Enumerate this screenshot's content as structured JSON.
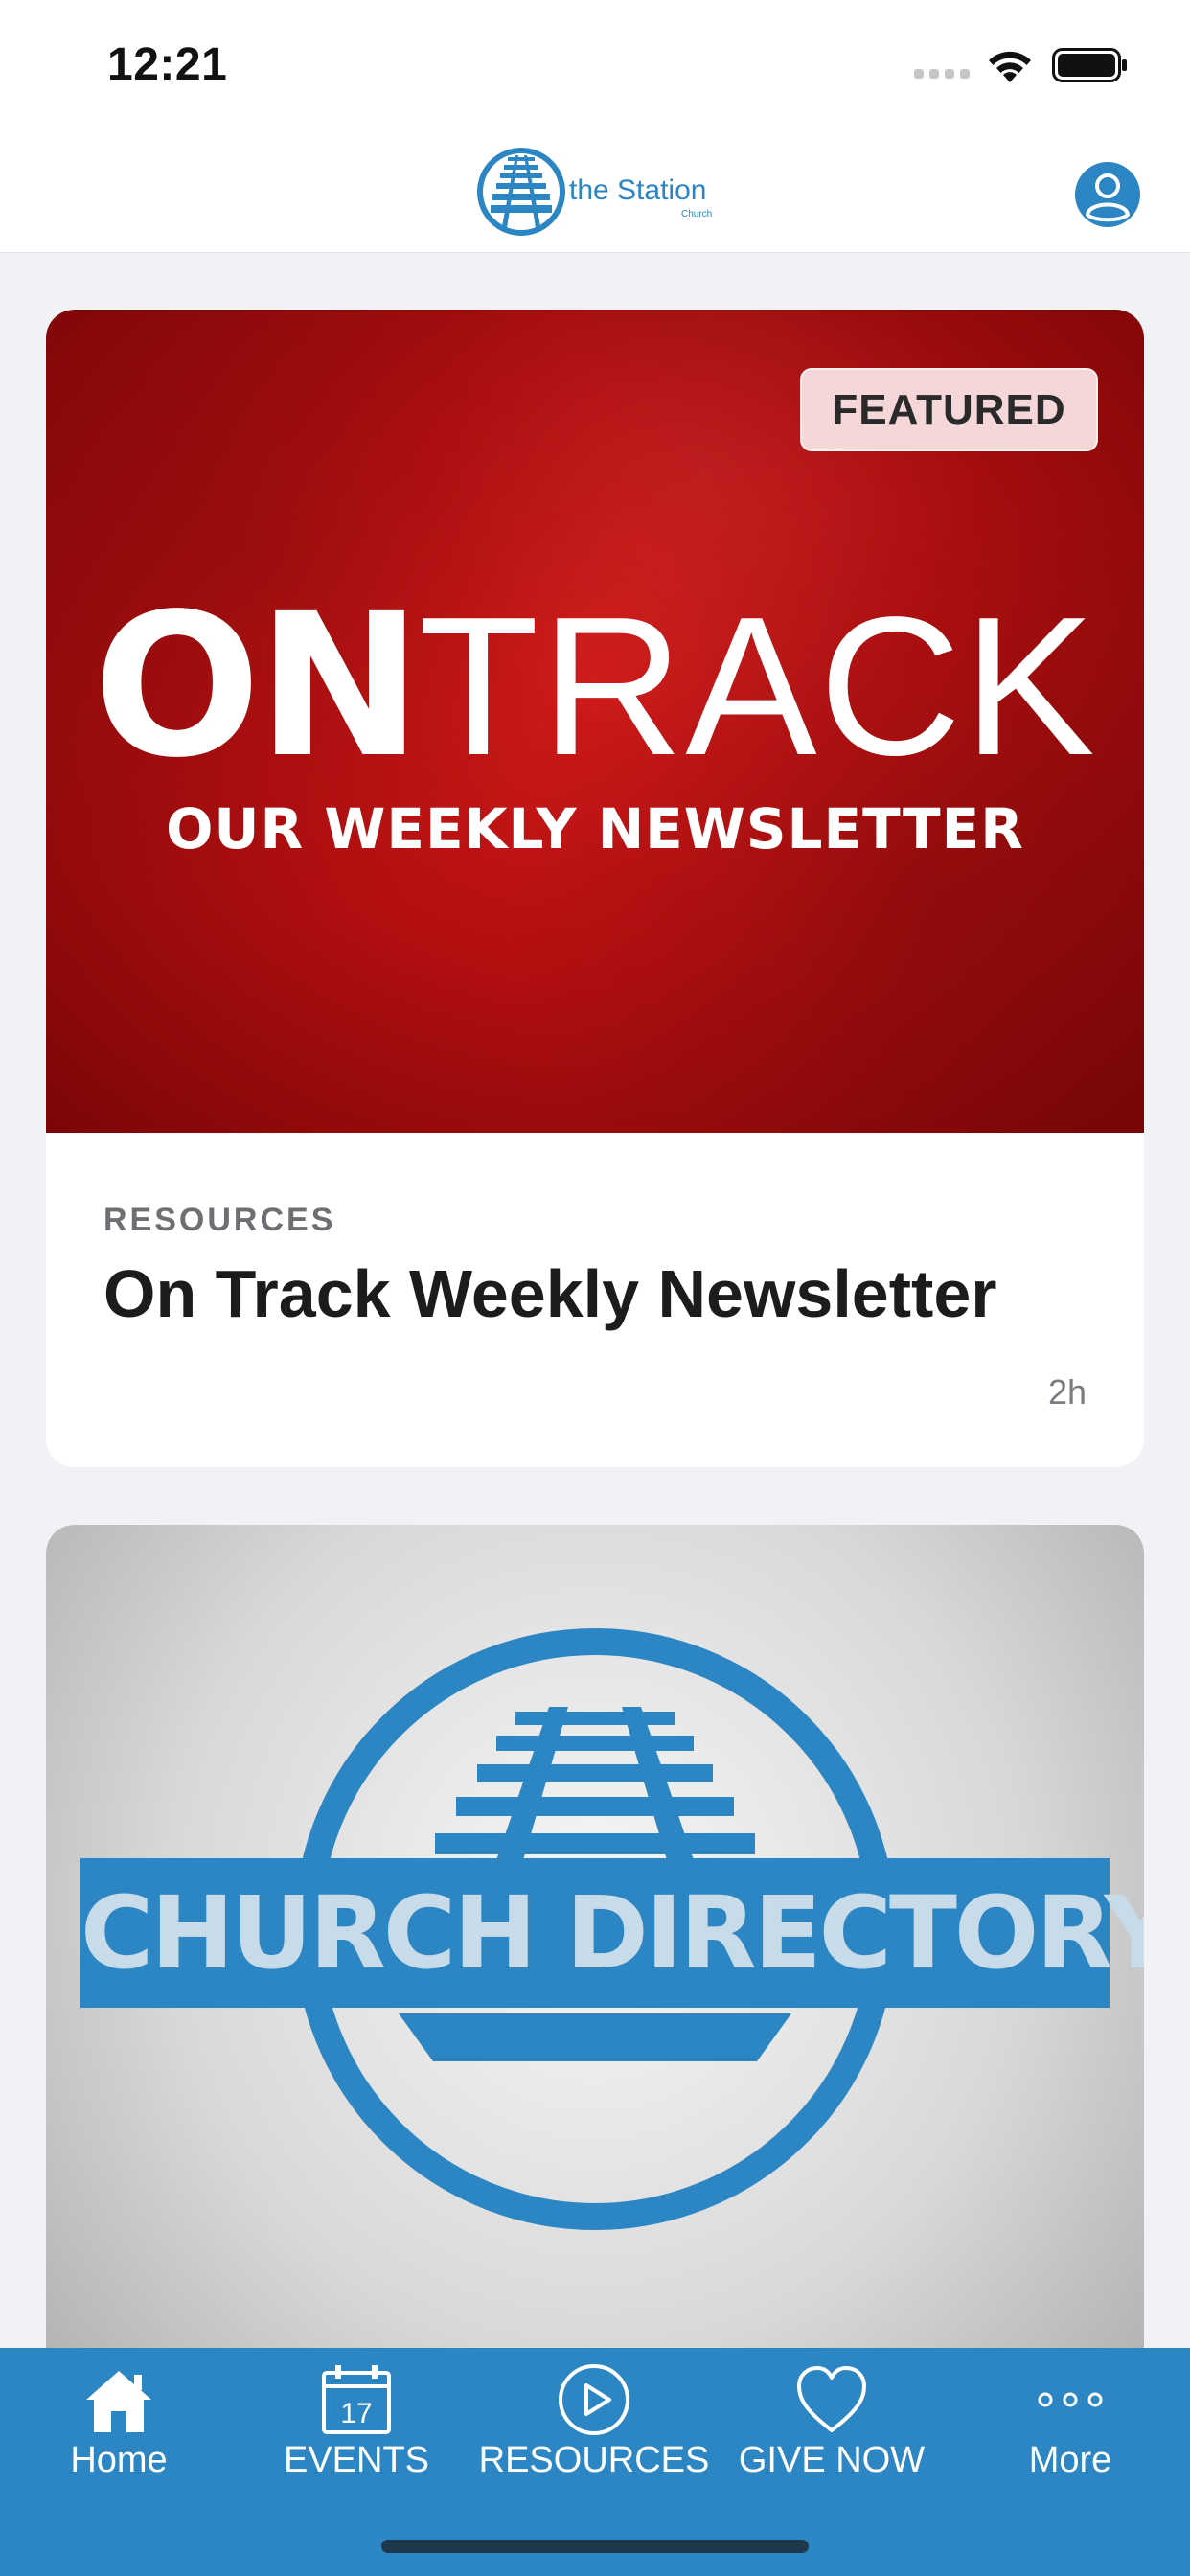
{
  "status_bar": {
    "time": "12:21"
  },
  "header": {
    "logo_text": "the Station",
    "logo_subtext": "Church"
  },
  "feed": {
    "cards": [
      {
        "badge": "FEATURED",
        "hero_title_bold": "ON",
        "hero_title_light": "TRACK",
        "hero_subtitle": "OUR WEEKLY NEWSLETTER",
        "category": "RESOURCES",
        "title": "On Track Weekly Newsletter",
        "time": "2h"
      },
      {
        "hero_text": "CHURCH DIRECTORY"
      }
    ]
  },
  "tab_bar": {
    "items": [
      {
        "label": "Home",
        "icon": "home-icon"
      },
      {
        "label": "EVENTS",
        "icon": "calendar-icon",
        "icon_text": "17"
      },
      {
        "label": "RESOURCES",
        "icon": "play-circle-icon"
      },
      {
        "label": "GIVE NOW",
        "icon": "heart-icon"
      },
      {
        "label": "More",
        "icon": "more-dots-icon"
      }
    ]
  },
  "colors": {
    "brand_blue": "#2d86c4",
    "hero_red": "#b30f10",
    "badge_bg": "#f5d7d9"
  }
}
